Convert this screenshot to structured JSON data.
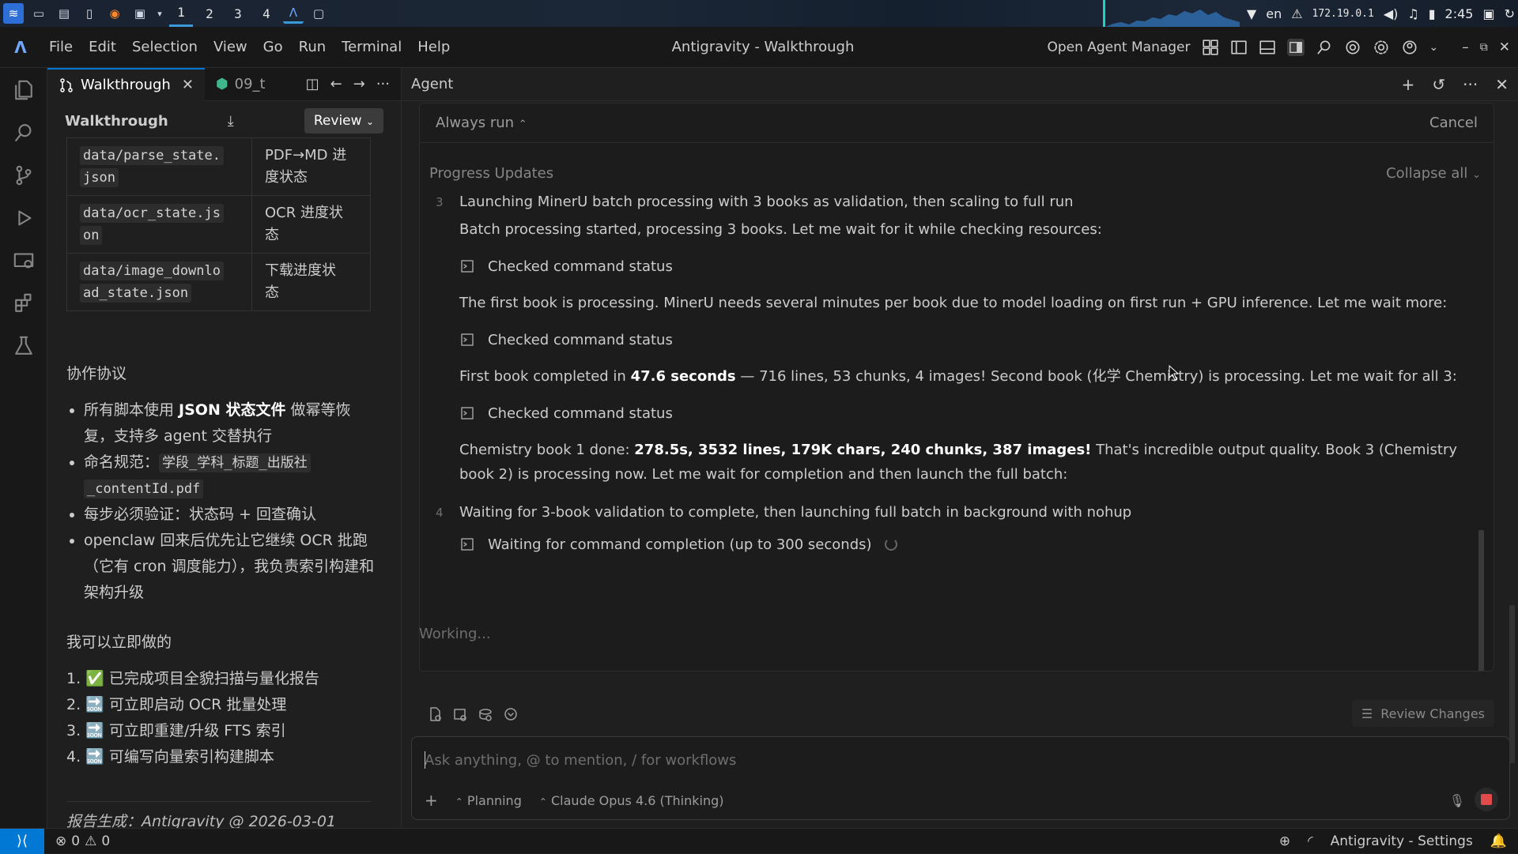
{
  "taskbar": {
    "workspaces": [
      "1",
      "2",
      "3",
      "4"
    ],
    "lang": "en",
    "ip": "172.19.0.1",
    "time": "2:45"
  },
  "titlebar": {
    "menu": [
      "File",
      "Edit",
      "Selection",
      "View",
      "Go",
      "Run",
      "Terminal",
      "Help"
    ],
    "title": "Antigravity - Walkthrough",
    "open_agent_manager": "Open Agent Manager"
  },
  "editor": {
    "tabs": [
      {
        "label": "Walkthrough",
        "active": true
      },
      {
        "label": "09_t",
        "active": false
      }
    ],
    "panel_title": "Walkthrough",
    "review_label": "Review",
    "state_table": [
      {
        "file": "data/parse_state.json",
        "file_line1": "data/parse_state.",
        "file_line2": "json",
        "desc_line1": "PDF→MD 进",
        "desc_line2": "度状态"
      },
      {
        "file": "data/ocr_state.json",
        "file_line1": "data/ocr_state.js",
        "file_line2": "on",
        "desc_line1": "OCR 进度状",
        "desc_line2": "态"
      },
      {
        "file": "data/image_download_state.json",
        "file_line1": "data/image_downlo",
        "file_line2": "ad_state.json",
        "desc_line1": "下载进度状",
        "desc_line2": "态"
      }
    ],
    "collab_heading": "协作协议",
    "collab_items": {
      "i1_pre": "所有脚本使用 ",
      "i1_bold": "JSON 状态文件",
      "i1_post": " 做幂等恢复，支持多 agent 交替执行",
      "i2_pre": "命名规范：",
      "i2_code1": "学段_学科_标题_出版社",
      "i2_code2": "_contentId.pdf",
      "i3": "每步必须验证：状态码 + 回查确认",
      "i4": "openclaw 回来后优先让它继续 OCR 批跑（它有 cron 调度能力），我负责索引构建和架构升级"
    },
    "todo_heading": "我可以立即做的",
    "todo_items": [
      "1. ✅ 已完成项目全貌扫描与量化报告",
      "2. 🔜 可立即启动 OCR 批量处理",
      "3. 🔜 可立即重建/升级 FTS 索引",
      "4. 🔜 可编写向量索引构建脚本"
    ],
    "footer": "报告生成：Antigravity @ 2026-03-01"
  },
  "agent": {
    "title": "Agent",
    "always_run": "Always run",
    "cancel": "Cancel",
    "progress_label": "Progress Updates",
    "collapse_all": "Collapse all",
    "step3_num": "3",
    "step3_title": "Launching MinerU batch processing with 3 books as validation, then scaling to full run",
    "p1": "Batch processing started, processing 3 books. Let me wait for it while checking resources:",
    "checked": "Checked command status",
    "p2": "The first book is processing. MinerU needs several minutes per book due to model loading on first run + GPU inference. Let me wait more:",
    "p3_pre": "First book completed in ",
    "p3_bold": "47.6 seconds",
    "p3_post": " — 716 lines, 53 chunks, 4 images! Second book (化学 Chemistry) is processing. Let me wait for all 3:",
    "p4_pre": "Chemistry book 1 done: ",
    "p4_bold": "278.5s, 3532 lines, 179K chars, 240 chunks, 387 images!",
    "p4_post": " That's incredible output quality. Book 3 (Chemistry book 2) is processing now. Let me wait for completion and then launch the full batch:",
    "step4_num": "4",
    "step4_title": "Waiting for 3-book validation to complete, then launching full batch in background with nohup",
    "waiting_cmd": "Waiting for command completion (up to 300 seconds)",
    "working": "Working...",
    "review_changes": "Review Changes",
    "input_placeholder": "Ask anything, @ to mention, / for workflows",
    "mode": "Planning",
    "model": "Claude Opus 4.6 (Thinking)"
  },
  "statusbar": {
    "errors": "0",
    "warnings": "0",
    "settings": "Antigravity - Settings"
  },
  "colors": {
    "accent": "#0078d4",
    "bg": "#1f1f1f",
    "stop": "#e04a4a"
  }
}
